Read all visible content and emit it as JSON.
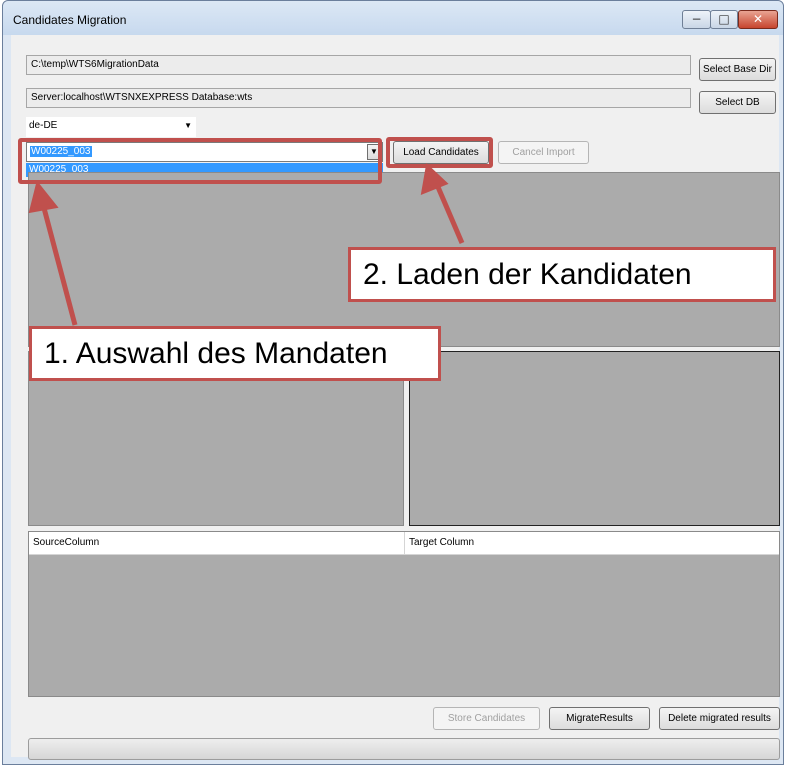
{
  "window": {
    "title": "Candidates Migration"
  },
  "paths": {
    "base_dir": "C:\\temp\\WTS6MigrationData",
    "server": "Server:localhost\\WTSNXEXPRESS Database:wts"
  },
  "buttons": {
    "select_base_dir": "Select Base Dir",
    "select_db": "Select DB",
    "load_candidates": "Load Candidates",
    "cancel_import": "Cancel Import",
    "store_candidates": "Store Candidates",
    "migrate_results": "MigrateResults",
    "delete_migrated": "Delete migrated results"
  },
  "language": {
    "selected": "de-DE"
  },
  "mandate": {
    "selected": "W00225_003",
    "options": [
      "W00225_003"
    ]
  },
  "mapping_grid": {
    "columns": [
      "SourceColumn",
      "Target Column"
    ]
  },
  "annotations": {
    "step1": "1. Auswahl des Mandaten",
    "step2": "2. Laden der Kandidaten",
    "color": "#c0504d"
  }
}
